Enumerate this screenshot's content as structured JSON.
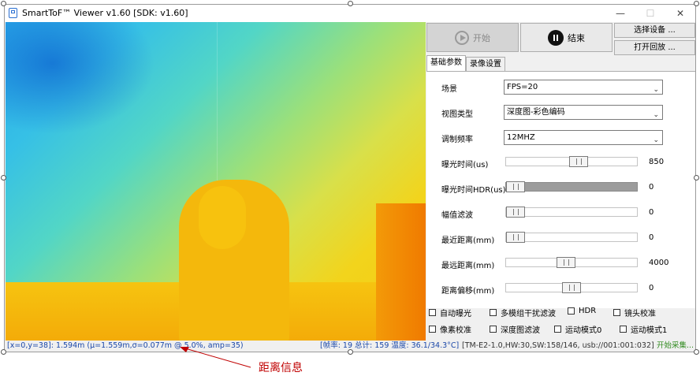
{
  "window": {
    "title": "SmartToF™ Viewer v1.60 [SDK: v1.60]",
    "minimize": "—",
    "maximize": "☐",
    "close": "✕"
  },
  "toolbar": {
    "start_label": "开始",
    "stop_label": "结束",
    "select_device_label": "选择设备 ...",
    "open_playback_label": "打开回放 ..."
  },
  "tabs": [
    {
      "label": "基础参数"
    },
    {
      "label": "录像设置"
    }
  ],
  "basic": {
    "scene": {
      "label": "场景",
      "value": "FPS=20"
    },
    "view_type": {
      "label": "视图类型",
      "value": "深度图-彩色编码"
    },
    "mod_freq": {
      "label": "调制频率",
      "value": "12MHZ"
    },
    "sliders": [
      {
        "label": "曝光时间(us)",
        "value": "850",
        "level": 0.56
      },
      {
        "label": "曝光时间HDR(us)",
        "value": "0",
        "level": 0.0
      },
      {
        "label": "幅值滤波",
        "value": "0",
        "level": 0.0
      },
      {
        "label": "最近距离(mm)",
        "value": "0",
        "level": 0.0
      },
      {
        "label": "最远距离(mm)",
        "value": "4000",
        "level": 0.45
      },
      {
        "label": "距离偏移(mm)",
        "value": "0",
        "level": 0.5
      }
    ],
    "checkboxes": [
      {
        "label": "自动曝光",
        "checked": false
      },
      {
        "label": "多模组干扰滤波",
        "checked": false
      },
      {
        "label": "HDR",
        "checked": false
      },
      {
        "label": "镜头校准",
        "checked": false
      },
      {
        "label": "像素校准",
        "checked": false
      },
      {
        "label": "深度图滤波",
        "checked": false
      },
      {
        "label": "运动模式0",
        "checked": false
      },
      {
        "label": "运动模式1",
        "checked": false
      }
    ]
  },
  "status": {
    "pixel_info": "[x=0,y=38]: 1.594m (μ=1.559m,σ=0.077m @ 5.0%, amp=35)",
    "frame_info": "[帧率: 19 总计: 159 温度: 36.1/34.3°C]",
    "device_info": "[TM-E2-1.0,HW:30,SW:158/146, usb://001:001:032]",
    "state": "开始采集..."
  },
  "annotation": {
    "label": "距离信息"
  },
  "colors": {
    "annotation": "#c00000",
    "status_text": "#1a47a8",
    "status_ok": "#2f8a1e"
  }
}
